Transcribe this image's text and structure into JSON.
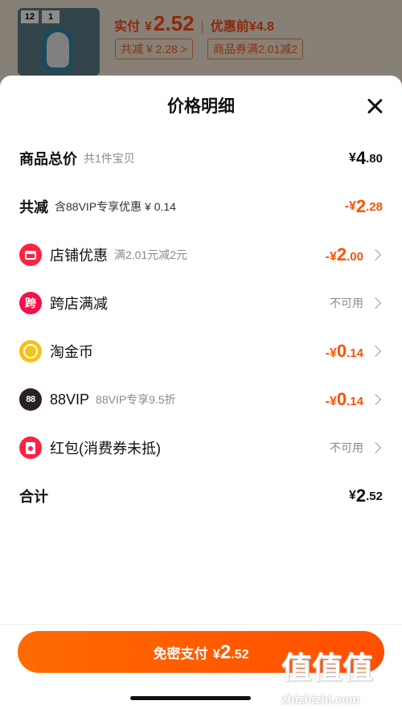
{
  "background": {
    "thumb_tag_1": "12",
    "thumb_tag_2": "1",
    "price_label": "实付",
    "price_yen": "¥",
    "price_value": "2.52",
    "orig_label": "优惠前",
    "orig_price": "¥4.8",
    "chip_total_discount": "共减 ¥ 2.28 >",
    "chip_coupon": "商品券满2.01减2"
  },
  "sheet": {
    "title": "价格明细",
    "rows": {
      "total": {
        "label": "商品总价",
        "sub": "共1件宝贝",
        "yen": "¥",
        "int": "4",
        "dec": ".80"
      },
      "reduce": {
        "label": "共减",
        "sub": "含88VIP专享优惠 ¥ 0.14",
        "sign": "-",
        "yen": "¥",
        "int": "2",
        "dec": ".28"
      },
      "shop": {
        "icon": "store-icon",
        "label": "店铺优惠",
        "sub": "满2.01元减2元",
        "sign": "-",
        "yen": "¥",
        "int": "2",
        "dec": ".00"
      },
      "cross": {
        "icon": "cross-store-icon",
        "icon_text": "跨",
        "label": "跨店满减",
        "status": "不可用"
      },
      "coin": {
        "icon": "gold-coin-icon",
        "label": "淘金币",
        "sign": "-",
        "yen": "¥",
        "int": "0",
        "dec": ".14"
      },
      "vip": {
        "icon": "vip-88-icon",
        "icon_text": "88",
        "label": "88VIP",
        "sub": "88VIP专享9.5折",
        "sign": "-",
        "yen": "¥",
        "int": "0",
        "dec": ".14"
      },
      "redpack": {
        "icon": "red-packet-icon",
        "label": "红包(消费券未抵)",
        "status": "不可用"
      },
      "sum": {
        "label": "合计",
        "yen": "¥",
        "int": "2",
        "dec": ".52"
      }
    },
    "pay_button": {
      "label": "免密支付",
      "yen": "¥",
      "int": "2",
      "dec": ".52"
    }
  },
  "watermark": {
    "logo": "值值值",
    "url": "zhizhizhi.com"
  },
  "colors": {
    "accent": "#ff5000",
    "text": "#111111",
    "muted": "#8a8a8a"
  }
}
